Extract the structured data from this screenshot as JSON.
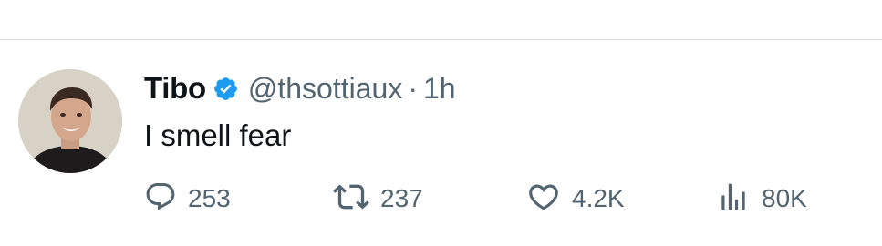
{
  "tweet": {
    "author_name": "Tibo",
    "handle": "@thsottiaux",
    "separator": "·",
    "time": "1h",
    "text": "I smell fear",
    "verified": true
  },
  "actions": {
    "replies": "253",
    "retweets": "237",
    "likes": "4.2K",
    "views": "80K"
  },
  "icons": {
    "verified": "verified-badge-icon",
    "reply": "reply-icon",
    "retweet": "retweet-icon",
    "like": "heart-icon",
    "views": "analytics-icon"
  },
  "colors": {
    "primary_text": "#0f1419",
    "secondary_text": "#536471",
    "verified_blue": "#1d9bf0",
    "divider": "#dcdcdc"
  }
}
